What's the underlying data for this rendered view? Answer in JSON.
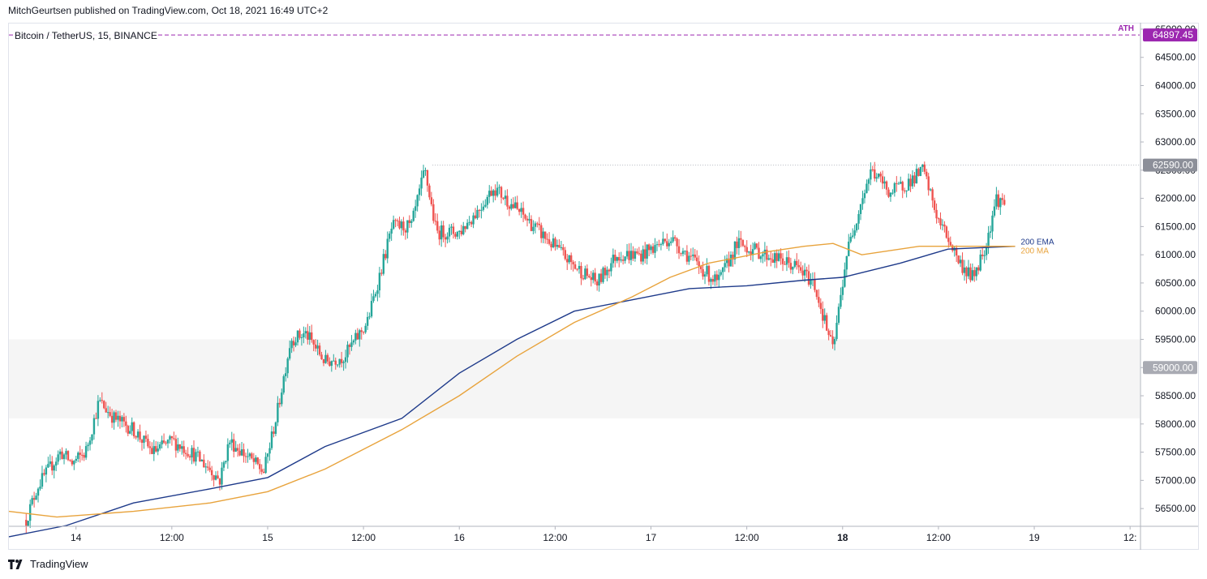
{
  "header": {
    "publisher": "MitchGeurtsen published on TradingView.com, Oct 18, 2021 16:49 UTC+2"
  },
  "symbol": {
    "title": "Bitcoin / TetherUS, 15, BINANCE"
  },
  "footer": {
    "brand": "TradingView",
    "logo_icon": "tradingview-logo-icon"
  },
  "colors": {
    "up": "#26a69a",
    "down": "#ef5350",
    "ema": "#1e3a8a",
    "ma": "#e8a33c",
    "ath": "#9c27b0",
    "zone": "#f5f5f5"
  },
  "chart_data": {
    "type": "candlestick",
    "ylim": [
      56200,
      65100
    ],
    "y_ticks": [
      "56500.00",
      "57000.00",
      "57500.00",
      "58000.00",
      "58500.00",
      "59000.00",
      "59500.00",
      "60000.00",
      "60500.00",
      "61000.00",
      "61500.00",
      "62000.00",
      "62500.00",
      "63000.00",
      "63500.00",
      "64000.00",
      "64500.00",
      "65000.00"
    ],
    "x_ticks": [
      {
        "label": "14",
        "x": 1.0,
        "bold": false
      },
      {
        "label": "12:00",
        "x": 1.5,
        "bold": false
      },
      {
        "label": "15",
        "x": 2.0,
        "bold": false
      },
      {
        "label": "12:00",
        "x": 2.5,
        "bold": false
      },
      {
        "label": "16",
        "x": 3.0,
        "bold": false
      },
      {
        "label": "12:00",
        "x": 3.5,
        "bold": false
      },
      {
        "label": "17",
        "x": 4.0,
        "bold": false
      },
      {
        "label": "12:00",
        "x": 4.5,
        "bold": false
      },
      {
        "label": "18",
        "x": 5.0,
        "bold": true
      },
      {
        "label": "12:00",
        "x": 5.5,
        "bold": false
      },
      {
        "label": "19",
        "x": 6.0,
        "bold": false
      },
      {
        "label": "12:",
        "x": 6.5,
        "bold": false
      }
    ],
    "x_range": [
      0.65,
      6.55
    ],
    "ath": {
      "label": "ATH",
      "value": 64897.45,
      "value_label": "64897.45"
    },
    "current": {
      "value": 62590,
      "label": "62590.00"
    },
    "zone": {
      "from": 58100,
      "to": 59500,
      "label": "59000.00",
      "label_value": 59000
    },
    "price_path": [
      [
        0.74,
        56300
      ],
      [
        0.8,
        56900
      ],
      [
        0.86,
        57200
      ],
      [
        0.92,
        57500
      ],
      [
        0.98,
        57300
      ],
      [
        1.05,
        57500
      ],
      [
        1.12,
        58400
      ],
      [
        1.2,
        58100
      ],
      [
        1.3,
        57900
      ],
      [
        1.4,
        57500
      ],
      [
        1.5,
        57700
      ],
      [
        1.6,
        57500
      ],
      [
        1.7,
        57200
      ],
      [
        1.75,
        57000
      ],
      [
        1.8,
        57700
      ],
      [
        1.9,
        57400
      ],
      [
        1.98,
        57150
      ],
      [
        2.05,
        58200
      ],
      [
        2.12,
        59500
      ],
      [
        2.2,
        59600
      ],
      [
        2.3,
        59100
      ],
      [
        2.4,
        59200
      ],
      [
        2.52,
        59800
      ],
      [
        2.65,
        61500
      ],
      [
        2.75,
        61500
      ],
      [
        2.82,
        62500
      ],
      [
        2.88,
        61400
      ],
      [
        3.0,
        61400
      ],
      [
        3.1,
        61800
      ],
      [
        3.18,
        62200
      ],
      [
        3.3,
        61800
      ],
      [
        3.45,
        61300
      ],
      [
        3.6,
        60800
      ],
      [
        3.72,
        60500
      ],
      [
        3.82,
        61000
      ],
      [
        3.95,
        61000
      ],
      [
        4.1,
        61300
      ],
      [
        4.25,
        60800
      ],
      [
        4.35,
        60500
      ],
      [
        4.45,
        61200
      ],
      [
        4.6,
        61000
      ],
      [
        4.75,
        60800
      ],
      [
        4.85,
        60500
      ],
      [
        4.95,
        59300
      ],
      [
        5.02,
        61000
      ],
      [
        5.1,
        62000
      ],
      [
        5.15,
        62500
      ],
      [
        5.25,
        62100
      ],
      [
        5.35,
        62300
      ],
      [
        5.42,
        62500
      ],
      [
        5.5,
        61600
      ],
      [
        5.55,
        61300
      ],
      [
        5.62,
        60800
      ],
      [
        5.68,
        60600
      ],
      [
        5.75,
        61200
      ],
      [
        5.8,
        62000
      ],
      [
        5.85,
        61900
      ]
    ],
    "series": [
      {
        "name": "200 EMA",
        "color": "#1e3a8a",
        "points": [
          [
            0.65,
            56000
          ],
          [
            0.95,
            56200
          ],
          [
            1.3,
            56600
          ],
          [
            1.7,
            56850
          ],
          [
            2.0,
            57050
          ],
          [
            2.3,
            57600
          ],
          [
            2.7,
            58100
          ],
          [
            3.0,
            58900
          ],
          [
            3.3,
            59500
          ],
          [
            3.6,
            60000
          ],
          [
            3.9,
            60200
          ],
          [
            4.2,
            60400
          ],
          [
            4.5,
            60450
          ],
          [
            4.8,
            60550
          ],
          [
            5.0,
            60600
          ],
          [
            5.3,
            60850
          ],
          [
            5.55,
            61100
          ],
          [
            5.9,
            61150
          ]
        ]
      },
      {
        "name": "200 MA",
        "color": "#e8a33c",
        "points": [
          [
            0.65,
            56450
          ],
          [
            0.9,
            56350
          ],
          [
            1.3,
            56450
          ],
          [
            1.7,
            56600
          ],
          [
            2.0,
            56800
          ],
          [
            2.3,
            57200
          ],
          [
            2.7,
            57900
          ],
          [
            3.0,
            58500
          ],
          [
            3.3,
            59200
          ],
          [
            3.6,
            59800
          ],
          [
            3.9,
            60250
          ],
          [
            4.1,
            60600
          ],
          [
            4.3,
            60850
          ],
          [
            4.6,
            61050
          ],
          [
            4.8,
            61150
          ],
          [
            4.95,
            61200
          ],
          [
            5.1,
            61000
          ],
          [
            5.4,
            61150
          ],
          [
            5.6,
            61150
          ],
          [
            5.9,
            61150
          ]
        ]
      }
    ]
  }
}
